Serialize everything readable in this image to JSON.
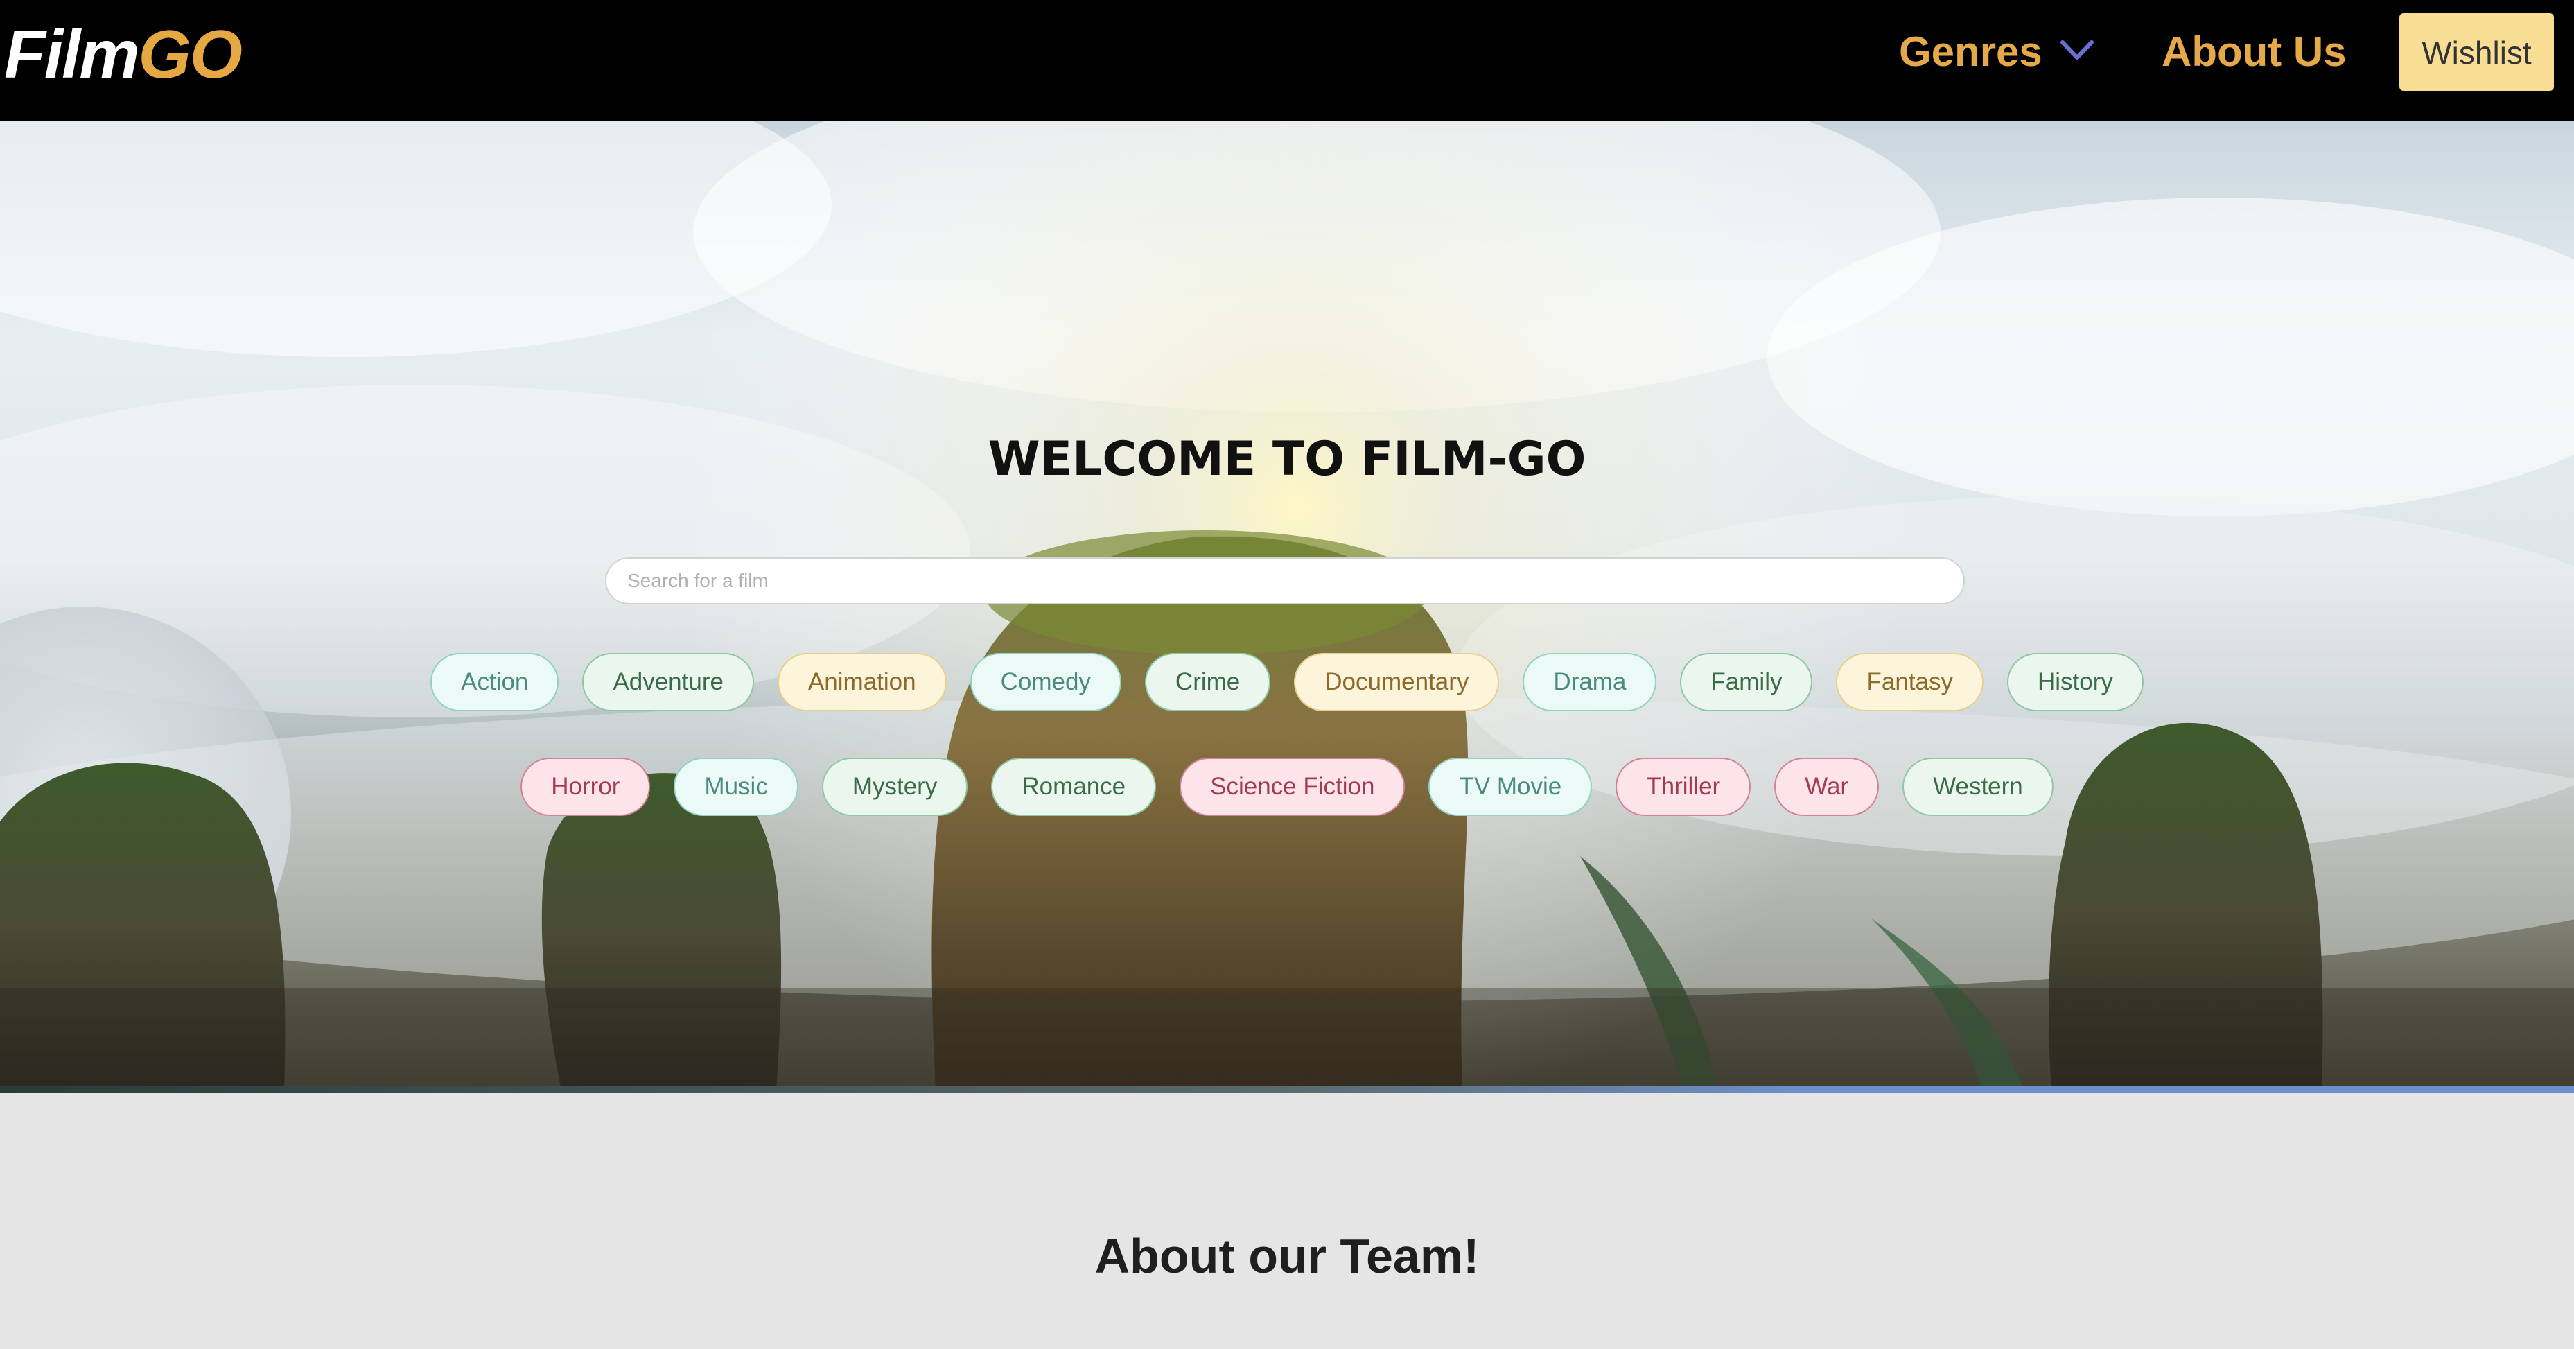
{
  "brand": {
    "logo_film": "Film",
    "logo_go": "GO"
  },
  "nav": {
    "genres_label": "Genres",
    "about_label": "About Us",
    "wishlist_label": "Wishlist"
  },
  "hero": {
    "title": "WELCOME TO FILM-GO",
    "search_placeholder": "Search for a film",
    "search_value": "",
    "genres_row1": [
      {
        "label": "Action",
        "style": "teal"
      },
      {
        "label": "Adventure",
        "style": "green"
      },
      {
        "label": "Animation",
        "style": "yellow"
      },
      {
        "label": "Comedy",
        "style": "teal"
      },
      {
        "label": "Crime",
        "style": "green"
      },
      {
        "label": "Documentary",
        "style": "yellow"
      },
      {
        "label": "Drama",
        "style": "teal"
      },
      {
        "label": "Family",
        "style": "green"
      },
      {
        "label": "Fantasy",
        "style": "yellow"
      },
      {
        "label": "History",
        "style": "green"
      }
    ],
    "genres_row2": [
      {
        "label": "Horror",
        "style": "red"
      },
      {
        "label": "Music",
        "style": "teal"
      },
      {
        "label": "Mystery",
        "style": "green"
      },
      {
        "label": "Romance",
        "style": "green"
      },
      {
        "label": "Science Fiction",
        "style": "red"
      },
      {
        "label": "TV Movie",
        "style": "teal"
      },
      {
        "label": "Thriller",
        "style": "red"
      },
      {
        "label": "War",
        "style": "red"
      },
      {
        "label": "Western",
        "style": "green"
      }
    ]
  },
  "about": {
    "title": "About our Team!"
  },
  "colors": {
    "nav_bg": "#000000",
    "accent_gold": "#e5a949",
    "wishlist_bg": "#f7de94",
    "chevron": "#6b6fd1",
    "section_bg": "#e5e5e5"
  },
  "icons": {
    "genres_dropdown": "chevron-down-icon"
  }
}
